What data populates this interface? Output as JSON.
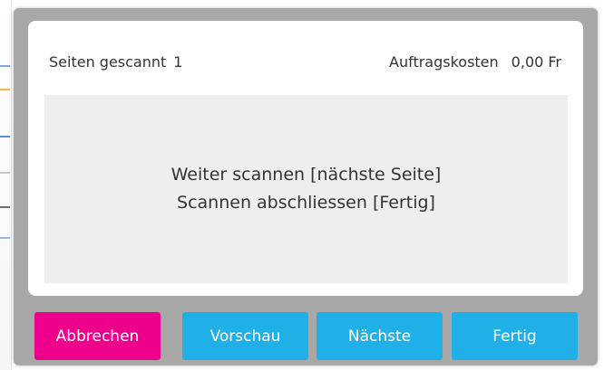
{
  "header": {
    "pages_label": "Seiten gescannt",
    "pages_count": "1",
    "cost_label": "Auftragskosten",
    "cost_value": "0,00 Fr"
  },
  "message": {
    "line1": "Weiter scannen [nächste Seite]",
    "line2": "Scannen abschliessen [Fertig]"
  },
  "buttons": {
    "cancel": "Abbrechen",
    "preview": "Vorschau",
    "next": "Nächste",
    "done": "Fertig"
  },
  "colors": {
    "cancel_button": "#ec008c",
    "primary_button": "#1fb0e8",
    "overlay": "#a8a8a8",
    "message_background": "#eeeeee"
  }
}
